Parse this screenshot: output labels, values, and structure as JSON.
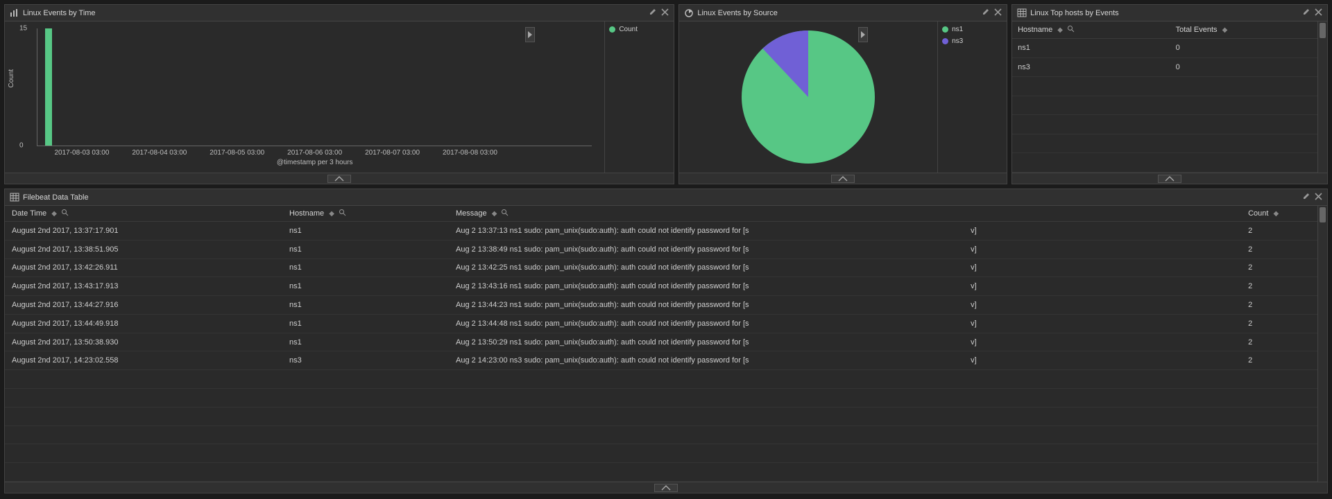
{
  "panels": {
    "events_by_time": {
      "title": "Linux Events by Time"
    },
    "events_by_source": {
      "title": "Linux Events by Source"
    },
    "top_hosts": {
      "title": "Linux Top hosts by Events"
    },
    "filebeat": {
      "title": "Filebeat Data Table"
    }
  },
  "chart_data": [
    {
      "id": "events_by_time",
      "type": "bar",
      "ylabel": "Count",
      "xlabel": "@timestamp per 3 hours",
      "ylim": [
        0,
        15
      ],
      "yticks": [
        0,
        15
      ],
      "categories": [
        "2017-08-03 03:00",
        "2017-08-04 03:00",
        "2017-08-05 03:00",
        "2017-08-06 03:00",
        "2017-08-07 03:00",
        "2017-08-08 03:00"
      ],
      "series": [
        {
          "name": "Count",
          "values": [
            15,
            0,
            0,
            0,
            0,
            0
          ],
          "color": "#57c785"
        }
      ],
      "legend": [
        {
          "label": "Count",
          "color": "#57c785"
        }
      ]
    },
    {
      "id": "events_by_source",
      "type": "pie",
      "values": [
        {
          "label": "ns1",
          "value": 88,
          "color": "#57c785"
        },
        {
          "label": "ns3",
          "value": 12,
          "color": "#7060d6"
        }
      ],
      "legend": [
        {
          "label": "ns1",
          "color": "#57c785"
        },
        {
          "label": "ns3",
          "color": "#7060d6"
        }
      ]
    }
  ],
  "top_hosts_table": {
    "columns": {
      "hostname": "Hostname",
      "total": "Total Events"
    },
    "rows": [
      {
        "hostname": "ns1",
        "total": "0"
      },
      {
        "hostname": "ns3",
        "total": "0"
      }
    ]
  },
  "filebeat_table": {
    "columns": {
      "datetime": "Date Time",
      "hostname": "Hostname",
      "message": "Message",
      "count": "Count"
    },
    "rows": [
      {
        "datetime": "August 2nd 2017, 13:37:17.901",
        "hostname": "ns1",
        "msg_a": "Aug 2 13:37:13 ns1 sudo: pam_unix(sudo:auth): auth could not identify password for [s",
        "msg_b": "v]",
        "count": "2"
      },
      {
        "datetime": "August 2nd 2017, 13:38:51.905",
        "hostname": "ns1",
        "msg_a": "Aug 2 13:38:49 ns1 sudo: pam_unix(sudo:auth): auth could not identify password for [s",
        "msg_b": "v]",
        "count": "2"
      },
      {
        "datetime": "August 2nd 2017, 13:42:26.911",
        "hostname": "ns1",
        "msg_a": "Aug 2 13:42:25 ns1 sudo: pam_unix(sudo:auth): auth could not identify password for [s",
        "msg_b": "v]",
        "count": "2"
      },
      {
        "datetime": "August 2nd 2017, 13:43:17.913",
        "hostname": "ns1",
        "msg_a": "Aug 2 13:43:16 ns1 sudo: pam_unix(sudo:auth): auth could not identify password for [s",
        "msg_b": "v]",
        "count": "2"
      },
      {
        "datetime": "August 2nd 2017, 13:44:27.916",
        "hostname": "ns1",
        "msg_a": "Aug 2 13:44:23 ns1 sudo: pam_unix(sudo:auth): auth could not identify password for [s",
        "msg_b": "v]",
        "count": "2"
      },
      {
        "datetime": "August 2nd 2017, 13:44:49.918",
        "hostname": "ns1",
        "msg_a": "Aug 2 13:44:48 ns1 sudo: pam_unix(sudo:auth): auth could not identify password for [s",
        "msg_b": "v]",
        "count": "2"
      },
      {
        "datetime": "August 2nd 2017, 13:50:38.930",
        "hostname": "ns1",
        "msg_a": "Aug 2 13:50:29 ns1 sudo: pam_unix(sudo:auth): auth could not identify password for [s",
        "msg_b": "v]",
        "count": "2"
      },
      {
        "datetime": "August 2nd 2017, 14:23:02.558",
        "hostname": "ns3",
        "msg_a": "Aug 2 14:23:00 ns3 sudo: pam_unix(sudo:auth): auth could not identify password for [s",
        "msg_b": "v]",
        "count": "2"
      }
    ]
  }
}
